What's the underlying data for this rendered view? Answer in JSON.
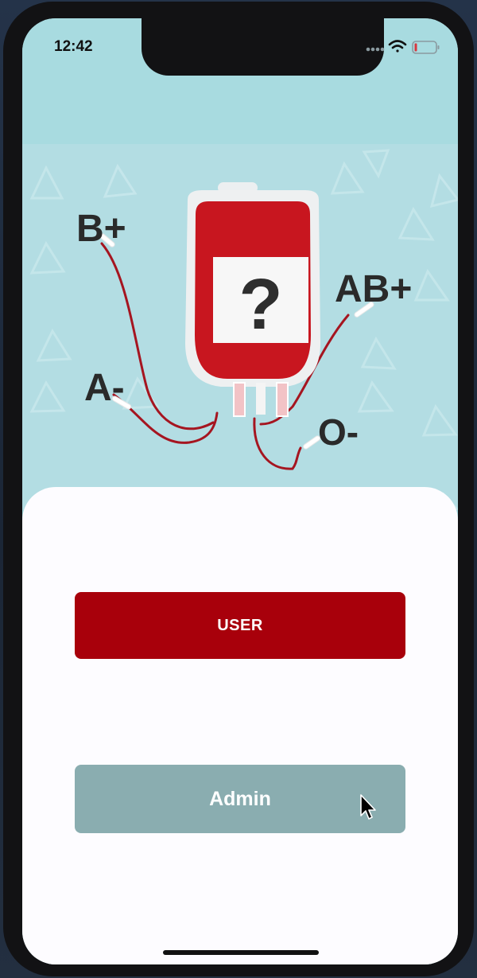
{
  "status_bar": {
    "time": "12:42"
  },
  "illustration": {
    "question_mark": "?",
    "blood_types": [
      "B+",
      "AB+",
      "A-",
      "O-"
    ],
    "colors": {
      "bag_red": "#c8161f",
      "tube_red": "#a51520",
      "background": "#b3dde3"
    }
  },
  "buttons": {
    "user_label": "USER",
    "admin_label": "Admin"
  },
  "colors": {
    "user_button": "#a8000b",
    "admin_button": "#8aadb0",
    "sheet": "#fdfcff"
  },
  "icons": {
    "signal": "cellular-signal-icon",
    "wifi": "wifi-icon",
    "battery": "battery-icon",
    "cursor": "mouse-cursor-icon"
  }
}
